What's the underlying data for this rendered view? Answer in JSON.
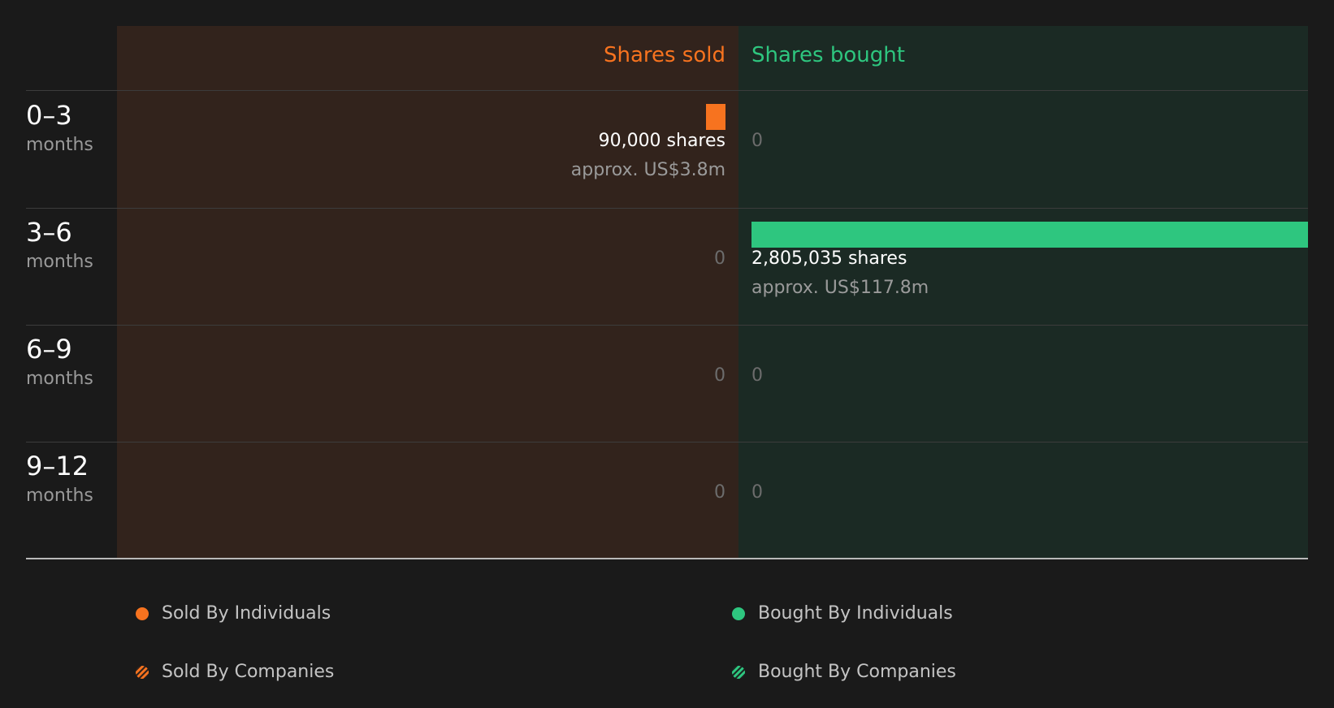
{
  "chart_data": {
    "type": "bar",
    "orientation": "diverging-horizontal",
    "headers": {
      "sold": "Shares sold",
      "bought": "Shares bought"
    },
    "periods": [
      {
        "range": "0–3",
        "unit": "months"
      },
      {
        "range": "3–6",
        "unit": "months"
      },
      {
        "range": "6–9",
        "unit": "months"
      },
      {
        "range": "9–12",
        "unit": "months"
      }
    ],
    "series": [
      {
        "name": "Shares sold",
        "values": [
          90000,
          0,
          0,
          0
        ],
        "labels": [
          "90,000 shares",
          "0",
          "0",
          "0"
        ],
        "approx": [
          "approx. US$3.8m",
          "",
          "",
          ""
        ]
      },
      {
        "name": "Shares bought",
        "values": [
          0,
          2805035,
          0,
          0
        ],
        "labels": [
          "0",
          "2,805,035 shares",
          "0",
          "0"
        ],
        "approx": [
          "",
          "approx. US$117.8m",
          "",
          ""
        ]
      }
    ],
    "xlim": [
      0,
      2805035
    ],
    "legend": [
      {
        "label": "Sold By Individuals",
        "color": "#f7731f",
        "style": "solid"
      },
      {
        "label": "Bought By Individuals",
        "color": "#2ec67f",
        "style": "solid"
      },
      {
        "label": "Sold By Companies",
        "color": "#f7731f",
        "style": "hatched"
      },
      {
        "label": "Bought By Companies",
        "color": "#2ec67f",
        "style": "hatched"
      }
    ],
    "legend_position": "bottom",
    "colors": {
      "sold": "#f7731f",
      "bought": "#2ec67f"
    }
  }
}
